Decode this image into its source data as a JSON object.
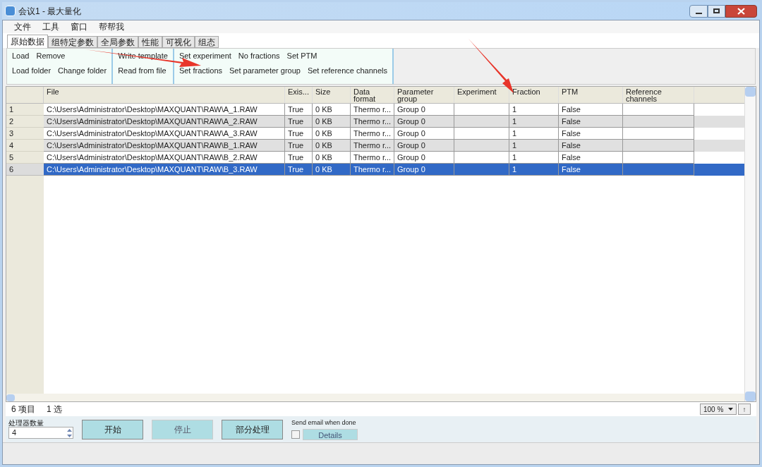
{
  "window": {
    "title": "会议1 - 最大量化"
  },
  "menu": [
    "文件",
    "工具",
    "窗口",
    "帮帮我"
  ],
  "tabs": [
    {
      "label": "原始数据",
      "selected": true
    },
    {
      "label": "组特定参数",
      "selected": false
    },
    {
      "label": "全局参数",
      "selected": false
    },
    {
      "label": "性能",
      "selected": false
    },
    {
      "label": "可视化",
      "selected": false
    },
    {
      "label": "组态",
      "selected": false
    }
  ],
  "ribbon_groups": [
    {
      "rows": [
        [
          "Load",
          "Remove"
        ],
        [
          "Load folder",
          "Change folder"
        ]
      ]
    },
    {
      "rows": [
        [
          "Write template"
        ],
        [
          "Read from file"
        ]
      ]
    },
    {
      "rows": [
        [
          "Set experiment",
          "No fractions",
          "Set PTM"
        ],
        [
          "Set fractions",
          "Set parameter group",
          "Set reference channels"
        ]
      ]
    }
  ],
  "table": {
    "columns": [
      "File",
      "Exis...",
      "Size",
      "Data format",
      "Parameter group",
      "Experiment",
      "Fraction",
      "PTM",
      "Reference channels"
    ],
    "rows": [
      {
        "index": "1",
        "selected": false,
        "cells": [
          "C:\\Users\\Administrator\\Desktop\\MAXQUANT\\RAW\\A_1.RAW",
          "True",
          "0 KB",
          "Thermo r...",
          "Group 0",
          "",
          "1",
          "False",
          ""
        ]
      },
      {
        "index": "2",
        "selected": false,
        "cells": [
          "C:\\Users\\Administrator\\Desktop\\MAXQUANT\\RAW\\A_2.RAW",
          "True",
          "0 KB",
          "Thermo r...",
          "Group 0",
          "",
          "1",
          "False",
          ""
        ]
      },
      {
        "index": "3",
        "selected": false,
        "cells": [
          "C:\\Users\\Administrator\\Desktop\\MAXQUANT\\RAW\\A_3.RAW",
          "True",
          "0 KB",
          "Thermo r...",
          "Group 0",
          "",
          "1",
          "False",
          ""
        ]
      },
      {
        "index": "4",
        "selected": false,
        "cells": [
          "C:\\Users\\Administrator\\Desktop\\MAXQUANT\\RAW\\B_1.RAW",
          "True",
          "0 KB",
          "Thermo r...",
          "Group 0",
          "",
          "1",
          "False",
          ""
        ]
      },
      {
        "index": "5",
        "selected": false,
        "cells": [
          "C:\\Users\\Administrator\\Desktop\\MAXQUANT\\RAW\\B_2.RAW",
          "True",
          "0 KB",
          "Thermo r...",
          "Group 0",
          "",
          "1",
          "False",
          ""
        ]
      },
      {
        "index": "6",
        "selected": true,
        "cells": [
          "C:\\Users\\Administrator\\Desktop\\MAXQUANT\\RAW\\B_3.RAW",
          "True",
          "0 KB",
          "Thermo r...",
          "Group 0",
          "",
          "1",
          "False",
          ""
        ]
      }
    ]
  },
  "status": {
    "items": "6 项目",
    "selected": "1 选",
    "zoom": "100 %",
    "up": "↑"
  },
  "bottom": {
    "threads_label": "处理器数量",
    "threads": "4",
    "buttons": [
      "开始",
      "停止",
      "部分处理"
    ],
    "email_label": "Send email when done",
    "email_checked": false,
    "details": "Details"
  }
}
